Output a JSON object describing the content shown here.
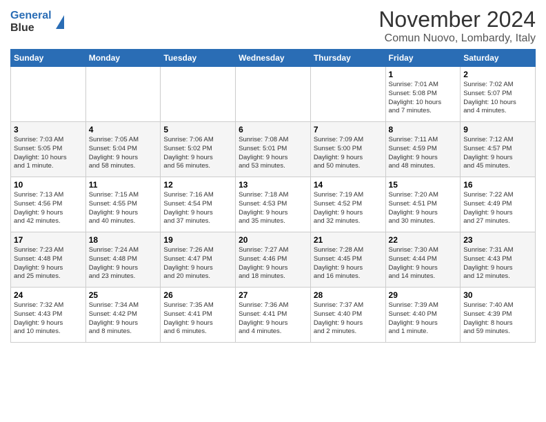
{
  "header": {
    "logo_line1": "General",
    "logo_line2": "Blue",
    "title": "November 2024",
    "subtitle": "Comun Nuovo, Lombardy, Italy"
  },
  "calendar": {
    "headers": [
      "Sunday",
      "Monday",
      "Tuesday",
      "Wednesday",
      "Thursday",
      "Friday",
      "Saturday"
    ],
    "weeks": [
      [
        {
          "day": "",
          "info": ""
        },
        {
          "day": "",
          "info": ""
        },
        {
          "day": "",
          "info": ""
        },
        {
          "day": "",
          "info": ""
        },
        {
          "day": "",
          "info": ""
        },
        {
          "day": "1",
          "info": "Sunrise: 7:01 AM\nSunset: 5:08 PM\nDaylight: 10 hours\nand 7 minutes."
        },
        {
          "day": "2",
          "info": "Sunrise: 7:02 AM\nSunset: 5:07 PM\nDaylight: 10 hours\nand 4 minutes."
        }
      ],
      [
        {
          "day": "3",
          "info": "Sunrise: 7:03 AM\nSunset: 5:05 PM\nDaylight: 10 hours\nand 1 minute."
        },
        {
          "day": "4",
          "info": "Sunrise: 7:05 AM\nSunset: 5:04 PM\nDaylight: 9 hours\nand 58 minutes."
        },
        {
          "day": "5",
          "info": "Sunrise: 7:06 AM\nSunset: 5:02 PM\nDaylight: 9 hours\nand 56 minutes."
        },
        {
          "day": "6",
          "info": "Sunrise: 7:08 AM\nSunset: 5:01 PM\nDaylight: 9 hours\nand 53 minutes."
        },
        {
          "day": "7",
          "info": "Sunrise: 7:09 AM\nSunset: 5:00 PM\nDaylight: 9 hours\nand 50 minutes."
        },
        {
          "day": "8",
          "info": "Sunrise: 7:11 AM\nSunset: 4:59 PM\nDaylight: 9 hours\nand 48 minutes."
        },
        {
          "day": "9",
          "info": "Sunrise: 7:12 AM\nSunset: 4:57 PM\nDaylight: 9 hours\nand 45 minutes."
        }
      ],
      [
        {
          "day": "10",
          "info": "Sunrise: 7:13 AM\nSunset: 4:56 PM\nDaylight: 9 hours\nand 42 minutes."
        },
        {
          "day": "11",
          "info": "Sunrise: 7:15 AM\nSunset: 4:55 PM\nDaylight: 9 hours\nand 40 minutes."
        },
        {
          "day": "12",
          "info": "Sunrise: 7:16 AM\nSunset: 4:54 PM\nDaylight: 9 hours\nand 37 minutes."
        },
        {
          "day": "13",
          "info": "Sunrise: 7:18 AM\nSunset: 4:53 PM\nDaylight: 9 hours\nand 35 minutes."
        },
        {
          "day": "14",
          "info": "Sunrise: 7:19 AM\nSunset: 4:52 PM\nDaylight: 9 hours\nand 32 minutes."
        },
        {
          "day": "15",
          "info": "Sunrise: 7:20 AM\nSunset: 4:51 PM\nDaylight: 9 hours\nand 30 minutes."
        },
        {
          "day": "16",
          "info": "Sunrise: 7:22 AM\nSunset: 4:49 PM\nDaylight: 9 hours\nand 27 minutes."
        }
      ],
      [
        {
          "day": "17",
          "info": "Sunrise: 7:23 AM\nSunset: 4:48 PM\nDaylight: 9 hours\nand 25 minutes."
        },
        {
          "day": "18",
          "info": "Sunrise: 7:24 AM\nSunset: 4:48 PM\nDaylight: 9 hours\nand 23 minutes."
        },
        {
          "day": "19",
          "info": "Sunrise: 7:26 AM\nSunset: 4:47 PM\nDaylight: 9 hours\nand 20 minutes."
        },
        {
          "day": "20",
          "info": "Sunrise: 7:27 AM\nSunset: 4:46 PM\nDaylight: 9 hours\nand 18 minutes."
        },
        {
          "day": "21",
          "info": "Sunrise: 7:28 AM\nSunset: 4:45 PM\nDaylight: 9 hours\nand 16 minutes."
        },
        {
          "day": "22",
          "info": "Sunrise: 7:30 AM\nSunset: 4:44 PM\nDaylight: 9 hours\nand 14 minutes."
        },
        {
          "day": "23",
          "info": "Sunrise: 7:31 AM\nSunset: 4:43 PM\nDaylight: 9 hours\nand 12 minutes."
        }
      ],
      [
        {
          "day": "24",
          "info": "Sunrise: 7:32 AM\nSunset: 4:43 PM\nDaylight: 9 hours\nand 10 minutes."
        },
        {
          "day": "25",
          "info": "Sunrise: 7:34 AM\nSunset: 4:42 PM\nDaylight: 9 hours\nand 8 minutes."
        },
        {
          "day": "26",
          "info": "Sunrise: 7:35 AM\nSunset: 4:41 PM\nDaylight: 9 hours\nand 6 minutes."
        },
        {
          "day": "27",
          "info": "Sunrise: 7:36 AM\nSunset: 4:41 PM\nDaylight: 9 hours\nand 4 minutes."
        },
        {
          "day": "28",
          "info": "Sunrise: 7:37 AM\nSunset: 4:40 PM\nDaylight: 9 hours\nand 2 minutes."
        },
        {
          "day": "29",
          "info": "Sunrise: 7:39 AM\nSunset: 4:40 PM\nDaylight: 9 hours\nand 1 minute."
        },
        {
          "day": "30",
          "info": "Sunrise: 7:40 AM\nSunset: 4:39 PM\nDaylight: 8 hours\nand 59 minutes."
        }
      ]
    ]
  }
}
